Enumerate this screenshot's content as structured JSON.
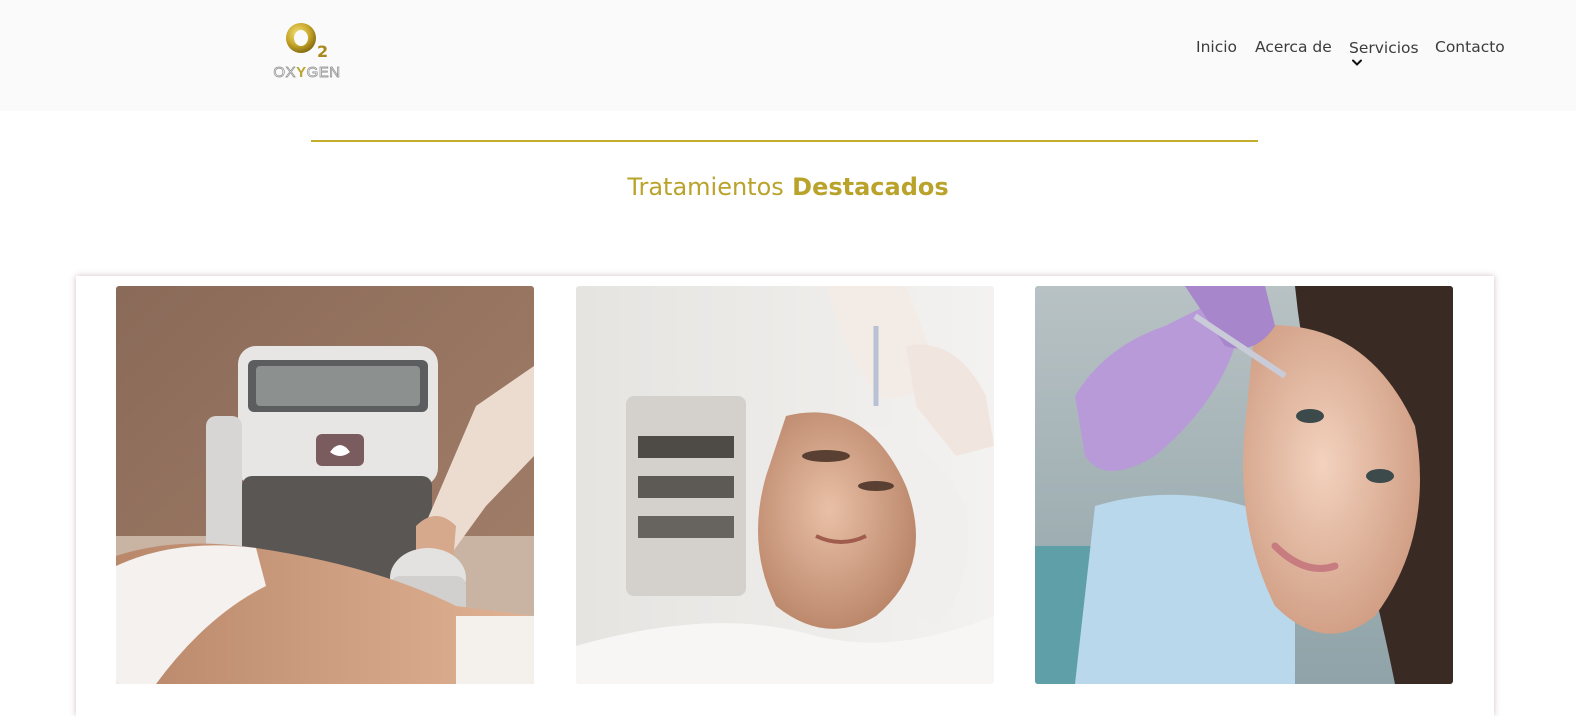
{
  "header": {
    "logo": {
      "mark": "O2",
      "text_before": "OX",
      "text_highlight": "Y",
      "text_after": "GEN"
    },
    "nav": [
      {
        "label": "Inicio"
      },
      {
        "label": "Acerca de"
      },
      {
        "label": "Servicios",
        "has_dropdown": true
      },
      {
        "label": "Contacto"
      }
    ]
  },
  "section": {
    "title_light": "Tratamientos",
    "title_bold": "Destacados"
  },
  "treatments": [
    {
      "image": "body-contouring-device-photo"
    },
    {
      "image": "facial-injection-man-photo"
    },
    {
      "image": "facial-injection-woman-photo"
    }
  ],
  "colors": {
    "accent": "#b9a32b",
    "header_bg": "#fafafa",
    "nav_text": "#3c3c3c"
  }
}
